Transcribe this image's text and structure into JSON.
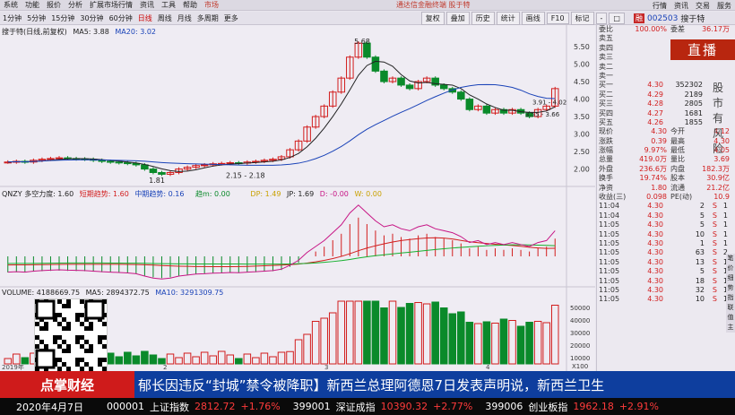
{
  "menubar": {
    "items": [
      "系统",
      "功能",
      "报价",
      "分析",
      "扩展市场行情",
      "资讯",
      "工具",
      "帮助",
      "市场"
    ],
    "notice": "通达信金融终端   股于特",
    "right_items": [
      "行情",
      "资讯",
      "交易",
      "服务"
    ]
  },
  "periodbar": {
    "items": [
      "1分钟",
      "5分钟",
      "15分钟",
      "30分钟",
      "60分钟",
      "日线",
      "周线",
      "月线",
      "多周期",
      "更多"
    ],
    "selected": "日线",
    "tools": [
      "复权",
      "叠加",
      "历史",
      "统计",
      "画线",
      "F10",
      "标记",
      "-",
      "□"
    ]
  },
  "stock": {
    "code": "002503",
    "name": "搜于特",
    "badge": "融"
  },
  "main_chart": {
    "title": "搜于特(日线,前复权)",
    "ma5": "MA5: 3.88",
    "ma20": "MA20: 3.02",
    "high_label": "5.68",
    "low_label": "1.81",
    "range_label_1": "2.15 - 2.18",
    "range_label_2": "3.91 - 4.02",
    "range_label_3": "3.55 - 3.66",
    "yaxis": [
      "5.50",
      "5.00",
      "4.50",
      "4.00",
      "3.50",
      "3.00",
      "2.50",
      "2.00"
    ]
  },
  "mid_chart": {
    "title": "QNZY 多空力度: 1.60",
    "s1": "短期趋势: 1.60",
    "s2": "中期趋势: 0.16",
    "s3": "趋m: 0.00",
    "s4": "DP: 1.49",
    "s5": "JP: 1.69",
    "s6": "D: -0.00",
    "s7": "W: 0.00",
    "labels": [
      "卖",
      "卖出",
      "低买",
      "低买"
    ]
  },
  "vol_chart": {
    "title": "VOLUME: 4188669.75",
    "ma5": "MA5: 2894372.75",
    "ma10": "MA10: 3291309.75",
    "yaxis": [
      "50000",
      "40000",
      "30000",
      "20000",
      "10000"
    ],
    "unit": "X100",
    "axis_marks": [
      "2019年",
      "2",
      "3",
      "4"
    ]
  },
  "quote": {
    "weibi": {
      "label": "委比",
      "v1": "100.00%",
      "v2": "委差",
      "v3": "36.17万"
    },
    "ask_labels": [
      "卖五",
      "卖四",
      "卖三",
      "卖二",
      "卖一"
    ],
    "bid": [
      {
        "label": "买一",
        "price": "4.30",
        "vol": "352302"
      },
      {
        "label": "买二",
        "price": "4.29",
        "vol": "2189"
      },
      {
        "label": "买三",
        "price": "4.28",
        "vol": "2805"
      },
      {
        "label": "买四",
        "price": "4.27",
        "vol": "1681"
      },
      {
        "label": "买五",
        "price": "4.26",
        "vol": "1855"
      }
    ],
    "stats": [
      {
        "l1": "现价",
        "v1": "4.30",
        "l2": "今开",
        "v2": "4.12"
      },
      {
        "l1": "涨跌",
        "v1": "0.39",
        "l2": "最高",
        "v2": "4.30"
      },
      {
        "l1": "涨幅",
        "v1": "9.97%",
        "l2": "最低",
        "v2": "4.05"
      },
      {
        "l1": "总量",
        "v1": "419.0万",
        "l2": "量比",
        "v2": "3.69"
      },
      {
        "l1": "外盘",
        "v1": "236.6万",
        "l2": "内盘",
        "v2": "182.3万"
      },
      {
        "l1": "换手",
        "v1": "19.74%",
        "l2": "股本",
        "v2": "30.9亿"
      },
      {
        "l1": "净资",
        "v1": "1.80",
        "l2": "流通",
        "v2": "21.2亿"
      },
      {
        "l1": "收益(三)",
        "v1": "0.098",
        "l2": "PE(动)",
        "v2": "10.9"
      }
    ],
    "ticks": [
      {
        "t": "11:04",
        "p": "4.30",
        "v": "2",
        "s": "S",
        "n": "1"
      },
      {
        "t": "11:04",
        "p": "4.30",
        "v": "5",
        "s": "S",
        "n": "1"
      },
      {
        "t": "11:05",
        "p": "4.30",
        "v": "5",
        "s": "S",
        "n": "1"
      },
      {
        "t": "11:05",
        "p": "4.30",
        "v": "10",
        "s": "S",
        "n": "1"
      },
      {
        "t": "11:05",
        "p": "4.30",
        "v": "1",
        "s": "S",
        "n": "1"
      },
      {
        "t": "11:05",
        "p": "4.30",
        "v": "63",
        "s": "S",
        "n": "2"
      },
      {
        "t": "11:05",
        "p": "4.30",
        "v": "13",
        "s": "S",
        "n": "1"
      },
      {
        "t": "11:05",
        "p": "4.30",
        "v": "5",
        "s": "S",
        "n": "1"
      },
      {
        "t": "11:05",
        "p": "4.30",
        "v": "18",
        "s": "S",
        "n": "1"
      },
      {
        "t": "11:05",
        "p": "4.30",
        "v": "32",
        "s": "S",
        "n": "1"
      },
      {
        "t": "11:05",
        "p": "4.30",
        "v": "10",
        "s": "S",
        "n": "1"
      }
    ],
    "live": "直播",
    "risk": "股市有风险",
    "side_tabs": [
      "笔",
      "价",
      "细",
      "势",
      "指",
      "联",
      "值",
      "主"
    ]
  },
  "banner": {
    "logo": "点掌财经",
    "news": "郁长因违反“封城”禁令被降职】新西兰总理阿德恩7日发表声明说，新西兰卫生"
  },
  "ticker": {
    "date": "2020年4月7日",
    "items": [
      {
        "code": "000001",
        "name": "上证指数",
        "value": "2812.72",
        "chg": "+1.76%"
      },
      {
        "code": "399001",
        "name": "深证成指",
        "value": "10390.32",
        "chg": "+2.77%"
      },
      {
        "code": "399006",
        "name": "创业板指",
        "value": "1962.18",
        "chg": "+2.91%"
      }
    ]
  },
  "colors": {
    "up": "#d21d1d",
    "down": "#0a8a2a",
    "banner": "#0e3e9e",
    "logo": "#cf1b1b"
  }
}
